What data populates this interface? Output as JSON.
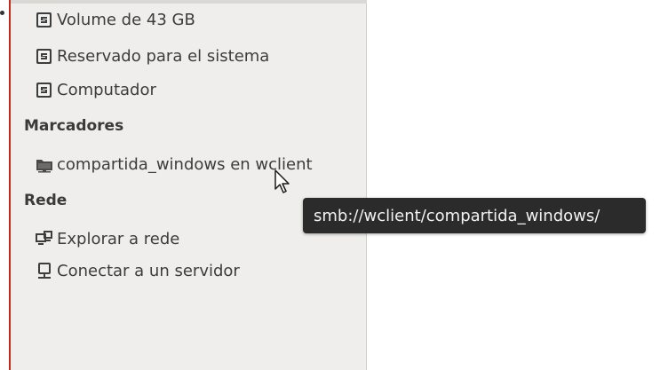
{
  "sidebar": {
    "devices": [
      {
        "label": "Volume de 43 GB",
        "icon": "drive-icon"
      },
      {
        "label": "Reservado para el sistema",
        "icon": "drive-icon"
      },
      {
        "label": "Computador",
        "icon": "drive-icon"
      }
    ],
    "bookmarks_header": "Marcadores",
    "bookmarks": [
      {
        "label": "compartida_windows en wclient",
        "icon": "network-share-icon"
      }
    ],
    "network_header": "Rede",
    "network": [
      {
        "label": "Explorar a rede",
        "icon": "network-icon"
      },
      {
        "label": "Conectar a un servidor",
        "icon": "server-icon"
      }
    ]
  },
  "tooltip": {
    "text": "smb://wclient/compartida_windows/"
  },
  "colors": {
    "sidebar_bg": "#efeeec",
    "accent_border": "#c22a1f",
    "tooltip_bg": "#2b2b2b",
    "tooltip_text": "#f2f2f2"
  }
}
